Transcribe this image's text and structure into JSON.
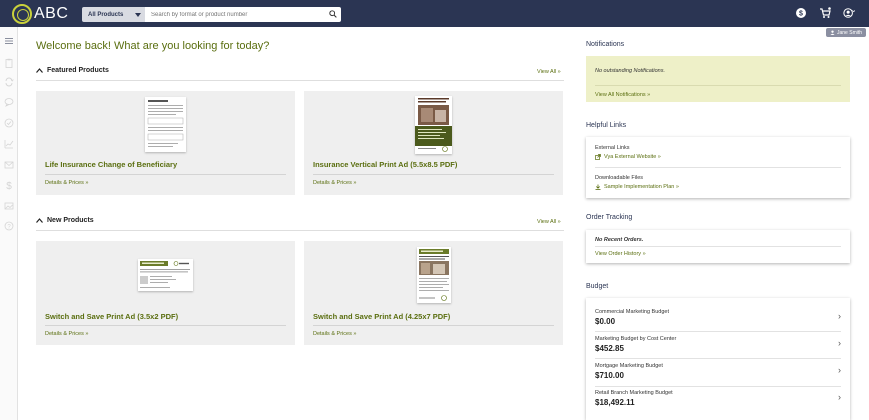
{
  "header": {
    "logo_text": "ABC",
    "search_category": "All Products",
    "search_placeholder": "Search by format or product number",
    "colors": {
      "bar": "#2b3553",
      "accent": "#5a6e0f",
      "logo": "#c9d13c"
    }
  },
  "user": {
    "name": "Jane Smith"
  },
  "sidebar": {
    "icons": [
      "menu-icon",
      "clipboard-icon",
      "refresh-icon",
      "chat-icon",
      "check-circle-icon",
      "chart-icon",
      "mail-icon",
      "dollar-icon",
      "image-icon",
      "help-icon"
    ]
  },
  "main": {
    "welcome": "Welcome back! What are you looking for today?",
    "featured": {
      "title": "Featured Products",
      "view_all": "View All »",
      "cards": [
        {
          "title": "Life Insurance Change of Beneficiary",
          "details": "Details & Prices »"
        },
        {
          "title": "Insurance Vertical Print Ad (5.5x8.5 PDF)",
          "details": "Details & Prices »"
        }
      ]
    },
    "new": {
      "title": "New Products",
      "view_all": "View All »",
      "cards": [
        {
          "title": "Switch and Save Print Ad (3.5x2 PDF)",
          "details": "Details & Prices »"
        },
        {
          "title": "Switch and Save Print Ad (4.25x7 PDF)",
          "details": "Details & Prices »"
        }
      ]
    }
  },
  "right": {
    "notifications": {
      "title": "Notifications",
      "message": "No outstanding Notifications.",
      "link": "View All Notifications »"
    },
    "helpful_links": {
      "title": "Helpful Links",
      "external_label": "External Links",
      "external_link": "Vya External Website »",
      "downloads_label": "Downloadable Files",
      "download_link": "Sample Implementation Plan »"
    },
    "order_tracking": {
      "title": "Order Tracking",
      "message": "No Recent Orders.",
      "link": "View Order History »"
    },
    "budget": {
      "title": "Budget",
      "rows": [
        {
          "name": "Commercial Marketing Budget",
          "amount": "$0.00"
        },
        {
          "name": "Marketing Budget by Cost Center",
          "amount": "$452.85"
        },
        {
          "name": "Mortgage Marketing Budget",
          "amount": "$710.00"
        },
        {
          "name": "Retail Branch Marketing Budget",
          "amount": "$18,492.11"
        }
      ]
    }
  }
}
